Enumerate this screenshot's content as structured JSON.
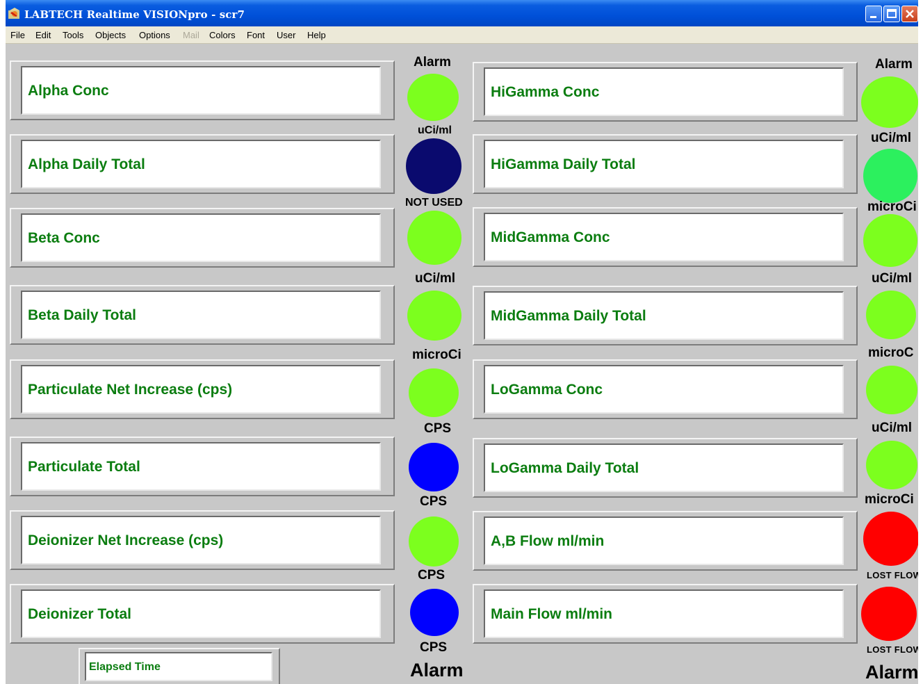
{
  "window": {
    "title": "LABTECH Realtime VISIONpro - scr7",
    "controls": [
      "minimize-icon",
      "maximize-icon",
      "close-icon"
    ]
  },
  "menu": [
    {
      "label": "File",
      "enabled": true
    },
    {
      "label": "Edit",
      "enabled": true
    },
    {
      "label": "Tools",
      "enabled": true
    },
    {
      "label": "Objects",
      "enabled": true
    },
    {
      "label": "Options",
      "enabled": true
    },
    {
      "label": "Mail",
      "enabled": false
    },
    {
      "label": "Colors",
      "enabled": true
    },
    {
      "label": "Font",
      "enabled": true
    },
    {
      "label": "User",
      "enabled": true
    },
    {
      "label": "Help",
      "enabled": true
    }
  ],
  "colors": {
    "label_green": "#0b7d10",
    "lamp_green": "#7cff1e",
    "lamp_green_alt": "#2cf05e",
    "lamp_navy": "#0a0a6e",
    "lamp_blue": "#0000ff",
    "lamp_red": "#ff0000"
  },
  "left_fields": [
    {
      "label": "Alpha Conc"
    },
    {
      "label": "Alpha Daily Total"
    },
    {
      "label": "Beta Conc"
    },
    {
      "label": "Beta Daily Total"
    },
    {
      "label": "Particulate Net Increase (cps)"
    },
    {
      "label": "Particulate Total"
    },
    {
      "label": "Deionizer Net Increase (cps)"
    },
    {
      "label": "Deionizer Total"
    }
  ],
  "right_fields": [
    {
      "label": "HiGamma Conc"
    },
    {
      "label": "HiGamma Daily Total"
    },
    {
      "label": "MidGamma Conc"
    },
    {
      "label": "MidGamma Daily Total"
    },
    {
      "label": "LoGamma Conc"
    },
    {
      "label": "LoGamma Daily Total"
    },
    {
      "label": "A,B Flow ml/min"
    },
    {
      "label": "Main Flow ml/min"
    }
  ],
  "middle_lamps": [
    {
      "state": "green",
      "color": "#7cff1e"
    },
    {
      "state": "navy",
      "color": "#0a0a6e"
    },
    {
      "state": "green",
      "color": "#7cff1e"
    },
    {
      "state": "green",
      "color": "#7cff1e"
    },
    {
      "state": "green",
      "color": "#7cff1e"
    },
    {
      "state": "blue",
      "color": "#0000ff"
    },
    {
      "state": "green",
      "color": "#7cff1e"
    },
    {
      "state": "blue",
      "color": "#0000ff"
    }
  ],
  "middle_labels": [
    "Alarm",
    "uCi/ml",
    "NOT USED",
    "uCi/ml",
    "microCi",
    "CPS",
    "CPS",
    "CPS",
    "CPS",
    "Alarm"
  ],
  "right_lamps": [
    {
      "state": "green",
      "color": "#7cff1e"
    },
    {
      "state": "green",
      "color": "#2cf05e"
    },
    {
      "state": "green",
      "color": "#7cff1e"
    },
    {
      "state": "green",
      "color": "#7cff1e"
    },
    {
      "state": "green",
      "color": "#7cff1e"
    },
    {
      "state": "green",
      "color": "#7cff1e"
    },
    {
      "state": "red",
      "color": "#ff0000"
    },
    {
      "state": "red",
      "color": "#ff0000"
    }
  ],
  "right_labels": [
    "Alarm",
    "uCi/ml",
    "microCi",
    "uCi/ml",
    "microC",
    "uCi/ml",
    "microCi",
    "LOST FLOW",
    "LOST FLOW",
    "Alarm"
  ],
  "elapsed": {
    "label": "Elapsed Time"
  }
}
